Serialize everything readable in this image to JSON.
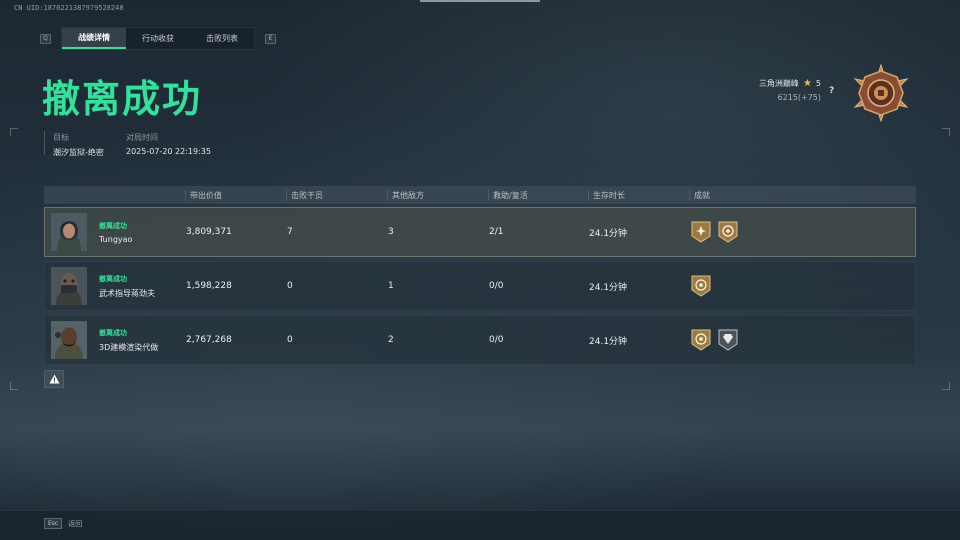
{
  "uid": "CN UID:1870221387979528248",
  "tabs": {
    "left_key": "Q",
    "right_key": "E",
    "items": [
      {
        "label": "战绩详情",
        "active": true
      },
      {
        "label": "行动收获",
        "active": false
      },
      {
        "label": "击败列表",
        "active": false
      }
    ]
  },
  "result_title": "撤离成功",
  "meta": {
    "target_label": "目标",
    "target_value": "潮汐监狱-绝密",
    "time_label": "对局时间",
    "time_value": "2025-07-20 22:19:35"
  },
  "rank": {
    "tier": "三角洲巅峰",
    "stars": "5",
    "score": "6215(+75)",
    "help": "?",
    "medal_icon": "rank-medal-icon"
  },
  "table": {
    "headers": [
      "带出价值",
      "击败干员",
      "其他敌方",
      "救助/复活",
      "生存时长",
      "成就"
    ],
    "rows": [
      {
        "status": "撤离成功",
        "name": "Tungyao",
        "value": "3,809,371",
        "kills": "7",
        "other": "3",
        "assist": "2/1",
        "survival": "24.1分钟",
        "badges": [
          "gold-star-badge-icon",
          "gold-compass-badge-icon"
        ]
      },
      {
        "status": "撤离成功",
        "name": "武术指导蒋劲夫",
        "value": "1,598,228",
        "kills": "0",
        "other": "1",
        "assist": "0/0",
        "survival": "24.1分钟",
        "badges": [
          "gold-compass-badge-icon"
        ]
      },
      {
        "status": "撤离成功",
        "name": "3D建模渲染代做",
        "value": "2,767,268",
        "kills": "0",
        "other": "2",
        "assist": "0/0",
        "survival": "24.1分钟",
        "badges": [
          "gold-compass-badge-icon",
          "silver-gem-badge-icon"
        ]
      }
    ]
  },
  "footer": {
    "esc_key": "Esc",
    "esc_label": "返回"
  },
  "colors": {
    "accent": "#2fe39a",
    "gold": "#c9a35a",
    "star": "#e8b84a"
  }
}
